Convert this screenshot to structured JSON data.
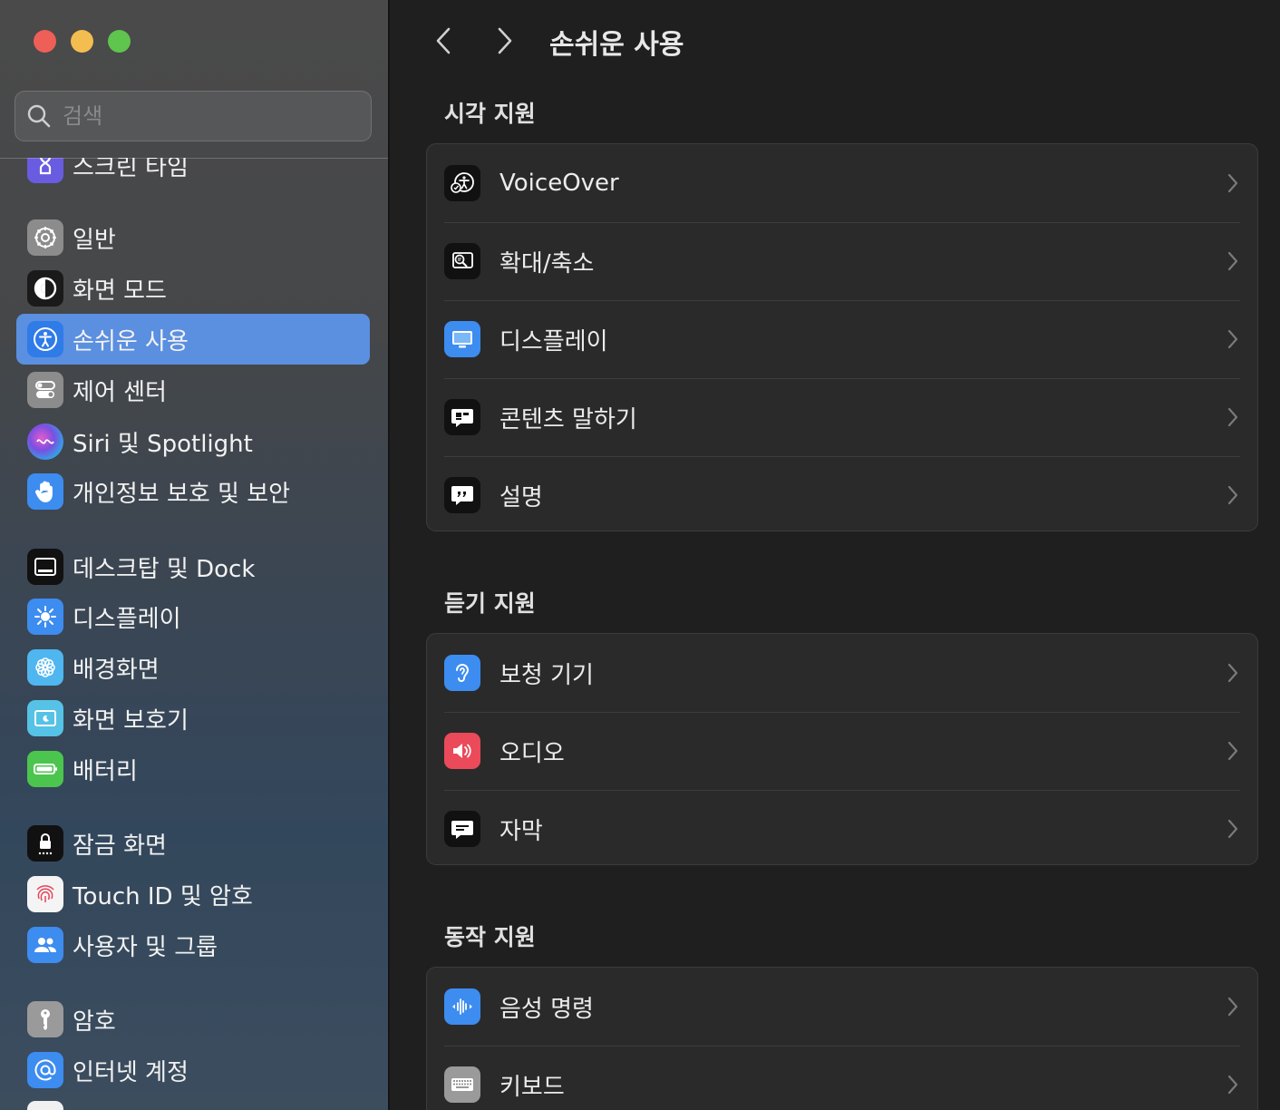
{
  "sidebar": {
    "search_placeholder": "검색",
    "items": [
      {
        "label": "스크린 타임"
      },
      {
        "label": "일반"
      },
      {
        "label": "화면 모드"
      },
      {
        "label": "손쉬운 사용"
      },
      {
        "label": "제어 센터"
      },
      {
        "label": "Siri 및 Spotlight"
      },
      {
        "label": "개인정보 보호 및 보안"
      },
      {
        "label": "데스크탑 및 Dock"
      },
      {
        "label": "디스플레이"
      },
      {
        "label": "배경화면"
      },
      {
        "label": "화면 보호기"
      },
      {
        "label": "배터리"
      },
      {
        "label": "잠금 화면"
      },
      {
        "label": "Touch ID 및 암호"
      },
      {
        "label": "사용자 및 그룹"
      },
      {
        "label": "암호"
      },
      {
        "label": "인터넷 계정"
      }
    ]
  },
  "header": {
    "title": "손쉬운 사용"
  },
  "sections": [
    {
      "title": "시각 지원",
      "rows": [
        {
          "label": "VoiceOver"
        },
        {
          "label": "확대/축소"
        },
        {
          "label": "디스플레이"
        },
        {
          "label": "콘텐츠 말하기"
        },
        {
          "label": "설명"
        }
      ]
    },
    {
      "title": "듣기 지원",
      "rows": [
        {
          "label": "보청 기기"
        },
        {
          "label": "오디오"
        },
        {
          "label": "자막"
        }
      ]
    },
    {
      "title": "동작 지원",
      "rows": [
        {
          "label": "음성 명령"
        },
        {
          "label": "키보드"
        }
      ]
    }
  ],
  "colors": {
    "selected": "#5b8fe0",
    "accent_blue": "#3d8cf0"
  }
}
